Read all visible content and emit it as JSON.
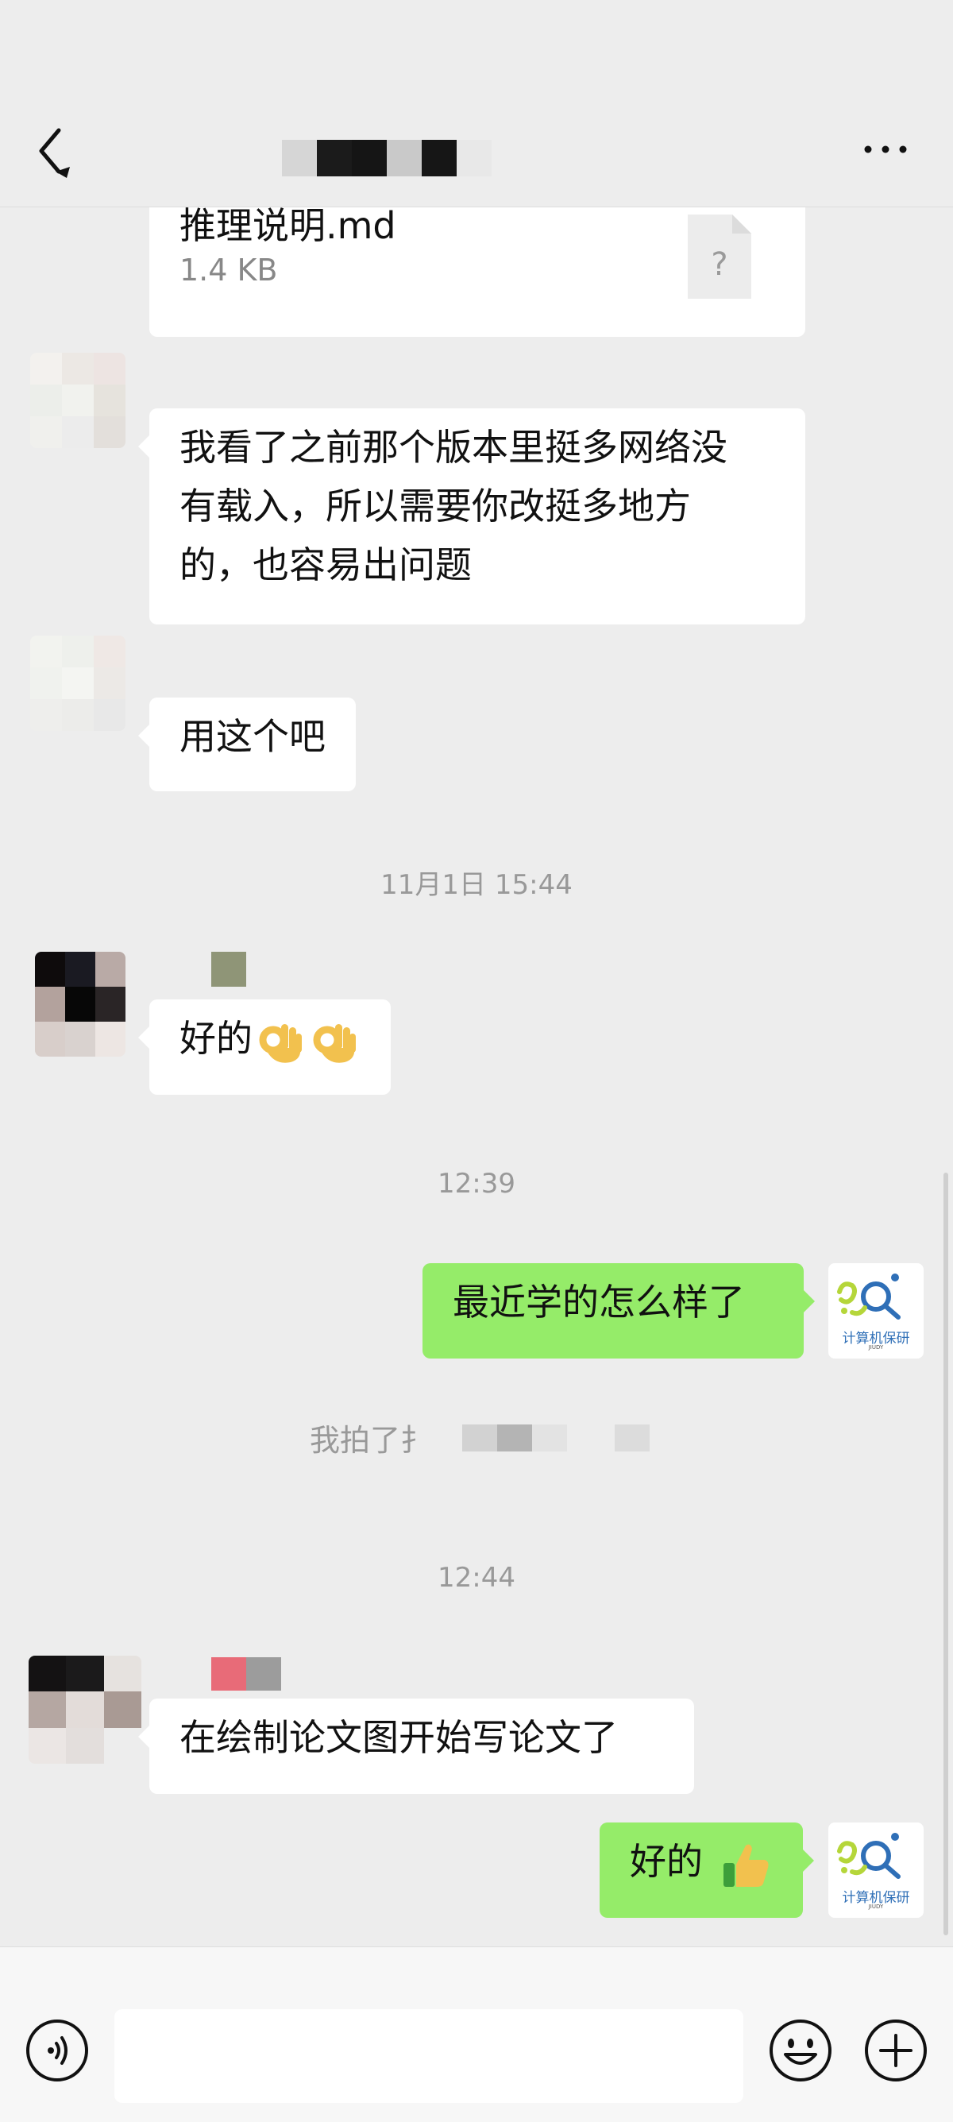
{
  "header": {
    "title_redacted": true,
    "back_icon": "chevron-left-icon",
    "more_icon": "more-dots-icon"
  },
  "messages": {
    "file": {
      "name": "推理说明.md",
      "size": "1.4 KB",
      "icon": "unknown-file-icon"
    },
    "msg1": "我看了之前那个版本里挺多网络没有载入，所以需要你改挺多地方的，也容易出问题",
    "msg1_line1": "我看了之前那个版本里挺多网络没",
    "msg1_line2": "有载入，所以需要你改挺多地方",
    "msg1_line3": "的，也容易出问题",
    "msg2": "用这个吧",
    "time1": "11月1日 15:44",
    "msg3": "好的",
    "msg3_emoji": "ok-hand-icon",
    "time2": "12:39",
    "msg4": "最近学的怎么样了",
    "system_msg": "我拍了扌",
    "time3": "12:44",
    "msg5": "在绘制论文图开始写论文了",
    "msg6": "好的",
    "msg6_emoji": "thumbs-up-icon"
  },
  "self_avatar": {
    "label": "计算机保研",
    "sub": "JIUDY"
  },
  "input_bar": {
    "voice_icon": "voice-icon",
    "emoji_icon": "emoji-icon",
    "plus_icon": "plus-icon",
    "input_value": ""
  },
  "colors": {
    "background": "#ededed",
    "bubble_self": "#95ec69",
    "bubble_other": "#ffffff",
    "timestamp": "#999999"
  }
}
